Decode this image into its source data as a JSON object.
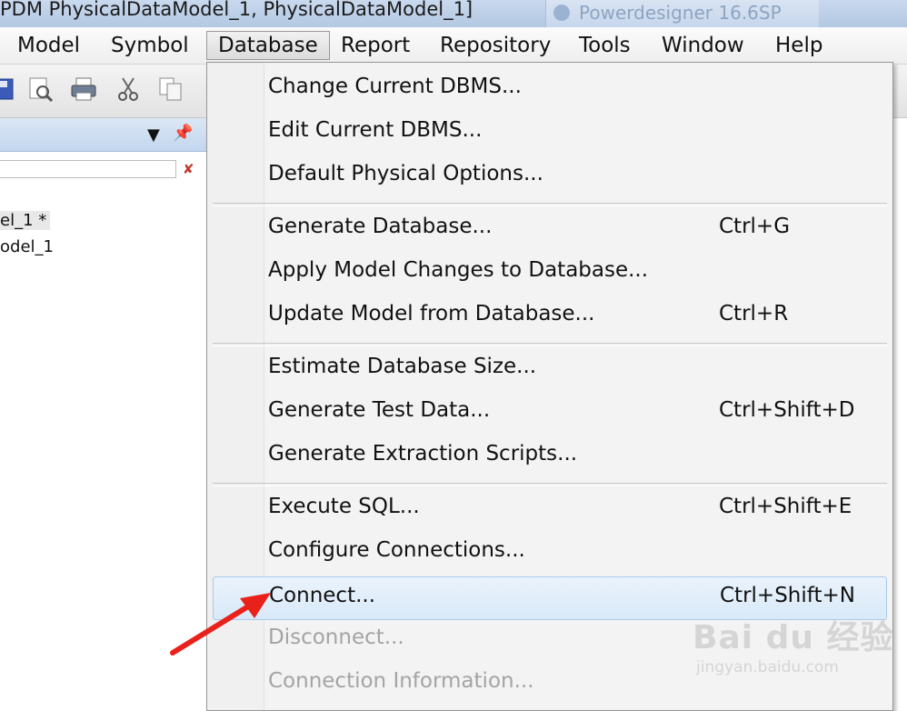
{
  "window": {
    "title": "PDM PhysicalDataModel_1, PhysicalDataModel_1]",
    "taskbar_title": "Powerdesigner 16.6SP"
  },
  "menubar": {
    "items": [
      "Model",
      "Symbol",
      "Database",
      "Report",
      "Repository",
      "Tools",
      "Window",
      "Help"
    ],
    "active": "Database"
  },
  "browser": {
    "tree": [
      "el_1 *",
      "odel_1"
    ]
  },
  "database_menu": {
    "groups": [
      [
        {
          "label": "Change Current DBMS...",
          "shortcut": ""
        },
        {
          "label": "Edit Current DBMS...",
          "shortcut": ""
        },
        {
          "label": "Default Physical Options...",
          "shortcut": ""
        }
      ],
      [
        {
          "label": "Generate Database...",
          "shortcut": "Ctrl+G"
        },
        {
          "label": "Apply Model Changes to Database...",
          "shortcut": ""
        },
        {
          "label": "Update Model from Database...",
          "shortcut": "Ctrl+R"
        }
      ],
      [
        {
          "label": "Estimate Database Size...",
          "shortcut": ""
        },
        {
          "label": "Generate Test Data...",
          "shortcut": "Ctrl+Shift+D"
        },
        {
          "label": "Generate Extraction Scripts...",
          "shortcut": ""
        }
      ],
      [
        {
          "label": "Execute SQL...",
          "shortcut": "Ctrl+Shift+E"
        },
        {
          "label": "Configure Connections...",
          "shortcut": ""
        },
        {
          "label": "Connect...",
          "shortcut": "Ctrl+Shift+N",
          "highlighted": true
        },
        {
          "label": "Disconnect...",
          "shortcut": "",
          "disabled": true
        },
        {
          "label": "Connection Information...",
          "shortcut": "",
          "disabled": true
        }
      ]
    ]
  },
  "watermark": {
    "brand": "Bai du 经验",
    "url": "jingyan.baidu.com"
  },
  "colors": {
    "hover_fill": "#dcebf9",
    "hover_border": "#a7cbed",
    "annotation_arrow": "#e8221b",
    "disabled_text": "#a4a4a4"
  },
  "icons": [
    "save-icon",
    "print-preview-icon",
    "print-icon",
    "cut-icon",
    "copy-icon",
    "dropdown-arrow-icon",
    "pin-icon",
    "filter-icon"
  ]
}
